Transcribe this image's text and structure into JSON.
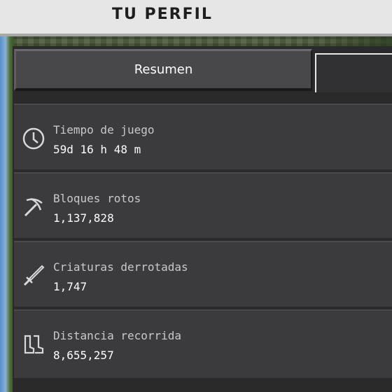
{
  "header": {
    "title": "TU PERFIL"
  },
  "tabs": [
    {
      "label": "Resumen",
      "active": true
    },
    {
      "label": "",
      "active": false
    }
  ],
  "stats": [
    {
      "icon": "clock-icon",
      "label": "Tiempo de juego",
      "value": "59d 16 h 48 m"
    },
    {
      "icon": "pickaxe-icon",
      "label": "Bloques rotos",
      "value": "1,137,828"
    },
    {
      "icon": "sword-icon",
      "label": "Criaturas derrotadas",
      "value": "1,747"
    },
    {
      "icon": "boots-icon",
      "label": "Distancia recorrida",
      "value": "8,655,257"
    }
  ]
}
